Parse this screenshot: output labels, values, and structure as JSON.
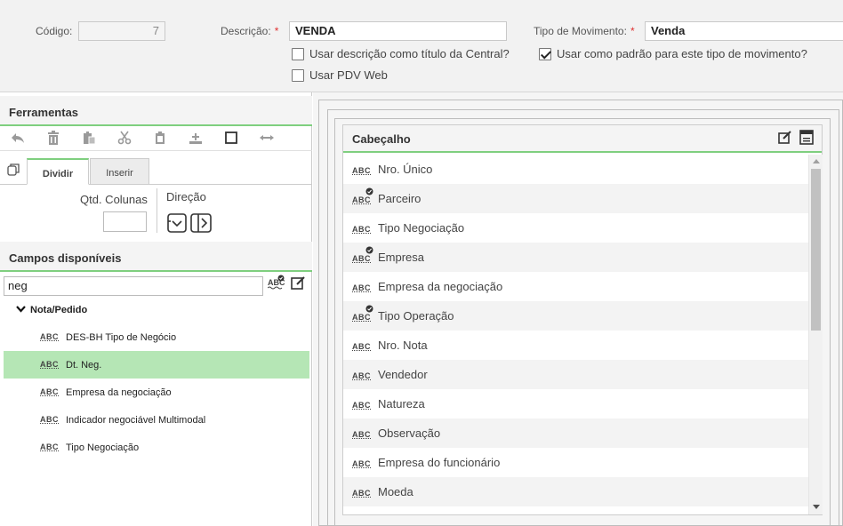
{
  "top": {
    "codigo_label": "Código:",
    "codigo_value": "7",
    "descricao_label": "Descrição:",
    "descricao_value": "VENDA",
    "tipo_label": "Tipo de Movimento:",
    "tipo_value": "Venda",
    "required_mark": "*",
    "chk_titulo": "Usar descrição como título da Central?",
    "chk_padrao": "Usar como padrão para este tipo de movimento?",
    "chk_pdv": "Usar PDV Web"
  },
  "ferramentas": {
    "title": "Ferramentas",
    "tabs": [
      "Dividir",
      "Inserir"
    ],
    "qtd_label": "Qtd. Colunas",
    "direcao_label": "Direção"
  },
  "campos": {
    "title": "Campos disponíveis",
    "search_value": "neg",
    "group": "Nota/Pedido",
    "items": [
      "DES-BH Tipo de Negócio",
      "Dt. Neg.",
      "Empresa da negociação",
      "Indicador negociável Multimodal",
      "Tipo Negociação"
    ],
    "selected_index": 1,
    "abc": "ABC"
  },
  "cabecalho": {
    "title": "Cabeçalho",
    "rows": [
      {
        "label": "Nro. Único",
        "checked": false
      },
      {
        "label": "Parceiro",
        "checked": true
      },
      {
        "label": "Tipo Negociação",
        "checked": false
      },
      {
        "label": "Empresa",
        "checked": true
      },
      {
        "label": "Empresa da negociação",
        "checked": false
      },
      {
        "label": "Tipo Operação",
        "checked": true
      },
      {
        "label": "Nro. Nota",
        "checked": false
      },
      {
        "label": "Vendedor",
        "checked": false
      },
      {
        "label": "Natureza",
        "checked": false
      },
      {
        "label": "Observação",
        "checked": false
      },
      {
        "label": "Empresa do funcionário",
        "checked": false
      },
      {
        "label": "Moeda",
        "checked": false
      }
    ]
  },
  "colors": {
    "accent_green": "#7fcf7f",
    "selected_row": "#b5e6b5",
    "required": "#e03131"
  }
}
